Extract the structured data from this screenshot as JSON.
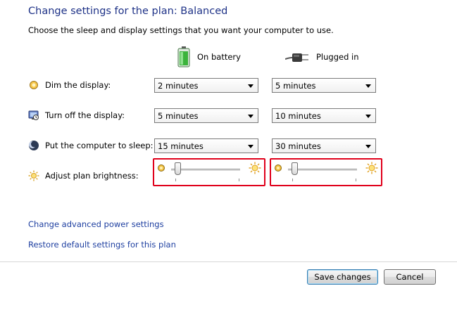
{
  "header": {
    "title": "Change settings for the plan: Balanced",
    "subtitle": "Choose the sleep and display settings that you want your computer to use."
  },
  "columns": {
    "battery": {
      "label": "On battery",
      "icon": "battery-icon"
    },
    "plugged": {
      "label": "Plugged in",
      "icon": "power-plug-icon"
    }
  },
  "rows": [
    {
      "label": "Dim the display:",
      "icon": "dim-display-icon",
      "battery": "2 minutes",
      "plugged": "5 minutes"
    },
    {
      "label": "Turn off the display:",
      "icon": "display-off-icon",
      "battery": "5 minutes",
      "plugged": "10 minutes"
    },
    {
      "label": "Put the computer to sleep:",
      "icon": "sleep-moon-icon",
      "battery": "15 minutes",
      "plugged": "30 minutes"
    }
  ],
  "brightness": {
    "label": "Adjust plan brightness:",
    "icon": "brightness-sun-icon",
    "battery_level": 0.1,
    "plugged_level": 0.1
  },
  "links": {
    "advanced": "Change advanced power settings",
    "restore": "Restore default settings for this plan"
  },
  "buttons": {
    "save": "Save changes",
    "cancel": "Cancel"
  },
  "colors": {
    "title": "#1e3287",
    "link": "#1e3fa0",
    "highlight": "#e0001b"
  }
}
